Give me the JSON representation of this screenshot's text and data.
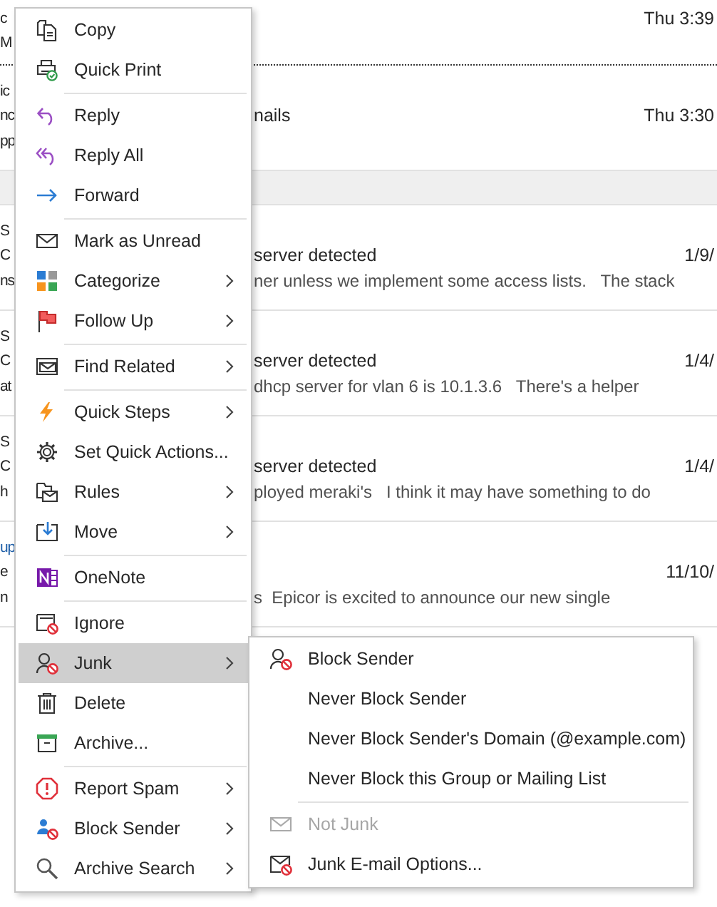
{
  "message_list": [
    {
      "kind": "message",
      "focused": true,
      "unread": false,
      "lines": [
        {
          "fragment": "c",
          "date": "Thu 3:39"
        },
        {
          "fragment": "M"
        }
      ]
    },
    {
      "kind": "message",
      "focused": false,
      "unread": false,
      "lines": [
        {
          "fragment": "ic"
        },
        {
          "fragment": "nc",
          "subject": "nails",
          "date": "Thu 3:30"
        },
        {
          "fragment": "pp"
        }
      ]
    },
    {
      "kind": "group_header"
    },
    {
      "kind": "message",
      "focused": false,
      "unread": false,
      "lines": [
        {
          "fragment": "S"
        },
        {
          "fragment": "C",
          "subject": "server detected",
          "date": "1/9/"
        },
        {
          "fragment": "ns",
          "preview": "ner unless we implement some access lists.   The stack"
        }
      ]
    },
    {
      "kind": "message",
      "focused": false,
      "unread": false,
      "lines": [
        {
          "fragment": "S"
        },
        {
          "fragment": "C",
          "subject": "server detected",
          "date": "1/4/"
        },
        {
          "fragment": "at",
          "preview": "dhcp server for vlan 6 is 10.1.3.6   There's a helper"
        }
      ]
    },
    {
      "kind": "message",
      "focused": false,
      "unread": false,
      "lines": [
        {
          "fragment": "S"
        },
        {
          "fragment": "C",
          "subject": "server detected",
          "date": "1/4/"
        },
        {
          "fragment": "h",
          "preview": "ployed meraki's   I think it may have something to do"
        }
      ]
    },
    {
      "kind": "message",
      "focused": false,
      "unread": true,
      "lines": [
        {
          "fragment": "up"
        },
        {
          "fragment": "e",
          "date": "11/10/"
        },
        {
          "fragment": "n",
          "preview": "s  Epicor is excited to announce our new single"
        }
      ]
    }
  ],
  "menu": {
    "items": [
      {
        "kind": "item",
        "label": "Copy",
        "has_arrow": false,
        "selected": false
      },
      {
        "kind": "item",
        "label": "Quick Print",
        "has_arrow": false,
        "selected": false
      },
      {
        "kind": "separator"
      },
      {
        "kind": "item",
        "label": "Reply",
        "has_arrow": false,
        "selected": false
      },
      {
        "kind": "item",
        "label": "Reply All",
        "has_arrow": false,
        "selected": false
      },
      {
        "kind": "item",
        "label": "Forward",
        "has_arrow": false,
        "selected": false
      },
      {
        "kind": "separator"
      },
      {
        "kind": "item",
        "label": "Mark as Unread",
        "has_arrow": false,
        "selected": false
      },
      {
        "kind": "item",
        "label": "Categorize",
        "has_arrow": true,
        "selected": false
      },
      {
        "kind": "item",
        "label": "Follow Up",
        "has_arrow": true,
        "selected": false
      },
      {
        "kind": "separator"
      },
      {
        "kind": "item",
        "label": "Find Related",
        "has_arrow": true,
        "selected": false
      },
      {
        "kind": "separator"
      },
      {
        "kind": "item",
        "label": "Quick Steps",
        "has_arrow": true,
        "selected": false
      },
      {
        "kind": "item",
        "label": "Set Quick Actions...",
        "has_arrow": false,
        "selected": false
      },
      {
        "kind": "item",
        "label": "Rules",
        "has_arrow": true,
        "selected": false
      },
      {
        "kind": "item",
        "label": "Move",
        "has_arrow": true,
        "selected": false
      },
      {
        "kind": "separator"
      },
      {
        "kind": "item",
        "label": "OneNote",
        "has_arrow": false,
        "selected": false
      },
      {
        "kind": "separator"
      },
      {
        "kind": "item",
        "label": "Ignore",
        "has_arrow": false,
        "selected": false
      },
      {
        "kind": "item",
        "label": "Junk",
        "has_arrow": true,
        "selected": true,
        "submenu": [
          {
            "kind": "item",
            "label": "Block Sender",
            "disabled": false
          },
          {
            "kind": "item",
            "label": "Never Block Sender",
            "disabled": false
          },
          {
            "kind": "item",
            "label": "Never Block Sender's Domain (@example.com)",
            "disabled": false
          },
          {
            "kind": "item",
            "label": "Never Block this Group or Mailing List",
            "disabled": false
          },
          {
            "kind": "separator"
          },
          {
            "kind": "item",
            "label": "Not Junk",
            "disabled": true
          },
          {
            "kind": "item",
            "label": "Junk E-mail Options...",
            "disabled": false
          }
        ]
      },
      {
        "kind": "item",
        "label": "Delete",
        "has_arrow": false,
        "selected": false
      },
      {
        "kind": "item",
        "label": "Archive...",
        "has_arrow": false,
        "selected": false
      },
      {
        "kind": "separator"
      },
      {
        "kind": "item",
        "label": "Report Spam",
        "has_arrow": true,
        "selected": false
      },
      {
        "kind": "item",
        "label": "Block Sender",
        "has_arrow": true,
        "selected": false
      },
      {
        "kind": "item",
        "label": "Archive Search",
        "has_arrow": true,
        "selected": false
      }
    ]
  }
}
